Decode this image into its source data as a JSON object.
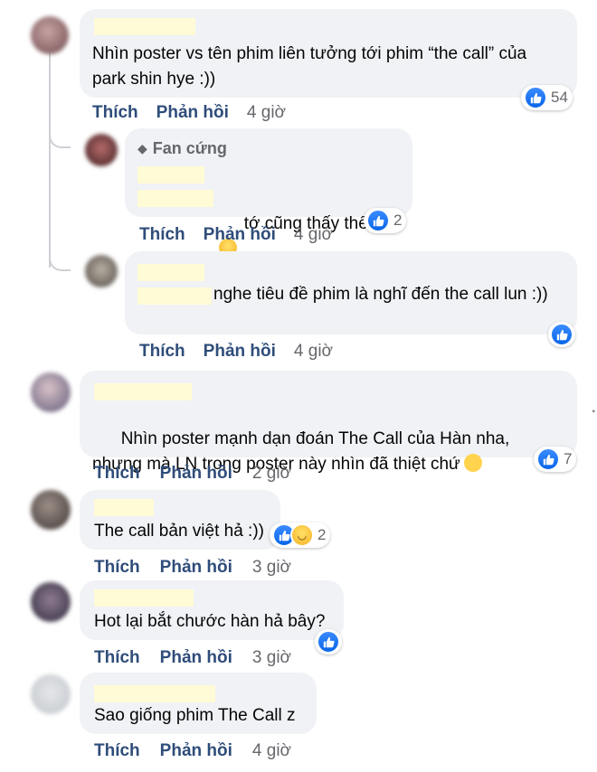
{
  "colors": {
    "bubble": "#f0f2f5",
    "action_text": "#2f4d7a",
    "time_text": "#65676b",
    "like_blue": "#0865e8",
    "name_redaction": "#fffbd6"
  },
  "actions": {
    "like": "Thích",
    "reply": "Phản hồi"
  },
  "comments": [
    {
      "text": "Nhìn poster vs tên phim liên tưởng tới phim “the call” của park shin hye :))",
      "time": "4 giờ",
      "reaction_count": "54",
      "replies": [
        {
          "badge": "Fan cứng",
          "text": "tớ cũng thấy thế nè",
          "time": "4 giờ",
          "reaction_count": "2"
        },
        {
          "text": "nghe tiêu đề phim là nghĩ đến the call lun :))",
          "time": "4 giờ",
          "reaction_count": ""
        }
      ]
    },
    {
      "text": "Nhìn poster mạnh dạn đoán The Call của Hàn nha, nhưng mà LN trong poster này nhìn đã thiệt chứ",
      "time": "2 giờ",
      "reaction_count": "7"
    },
    {
      "text": "The call bản việt hả :))",
      "time": "3 giờ",
      "reaction_count": "2"
    },
    {
      "text": "Hot lại bắt chước hàn hả bây?",
      "time": "3 giờ",
      "reaction_count": ""
    },
    {
      "text": "Sao giống phim The Call z",
      "time": "4 giờ",
      "reaction_count": ""
    }
  ]
}
